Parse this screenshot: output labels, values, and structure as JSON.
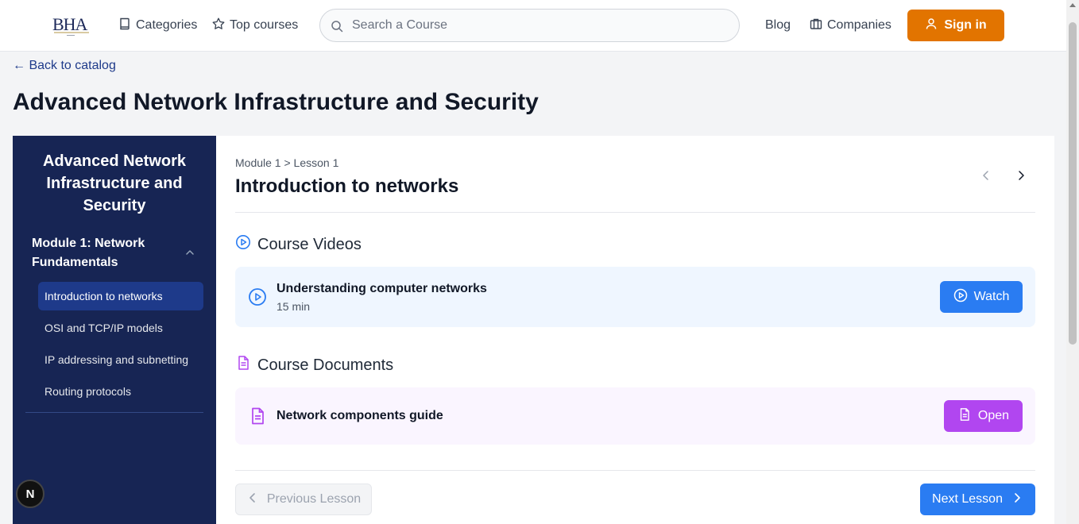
{
  "header": {
    "logo_text": "BHA",
    "nav": {
      "categories": "Categories",
      "top_courses": "Top courses",
      "blog": "Blog",
      "companies": "Companies"
    },
    "search_placeholder": "Search a Course",
    "sign_in": "Sign in",
    "accent_color": "#e27400"
  },
  "page": {
    "back_link": "← Back to catalog",
    "title": "Advanced Network Infrastructure and Security"
  },
  "sidebar": {
    "course_title": "Advanced Network Infrastructure and Security",
    "module": {
      "title": "Module 1: Network Fundamentals",
      "expanded": true,
      "lessons": [
        {
          "label": "Introduction to networks",
          "active": true
        },
        {
          "label": "OSI and TCP/IP models",
          "active": false
        },
        {
          "label": "IP addressing and subnetting",
          "active": false
        },
        {
          "label": "Routing protocols",
          "active": false
        }
      ]
    },
    "bg_color": "#172554"
  },
  "content": {
    "breadcrumb": "Module 1 > Lesson 1",
    "lesson_title": "Introduction to networks",
    "videos_heading": "Course Videos",
    "video": {
      "title": "Understanding computer networks",
      "duration": "15 min",
      "action": "Watch"
    },
    "documents_heading": "Course Documents",
    "document": {
      "title": "Network components guide",
      "action": "Open"
    },
    "prev_label": "Previous Lesson",
    "next_label": "Next Lesson",
    "video_color": "#2a7cf2",
    "doc_color": "#b146f0"
  },
  "badge": {
    "letter": "N"
  }
}
